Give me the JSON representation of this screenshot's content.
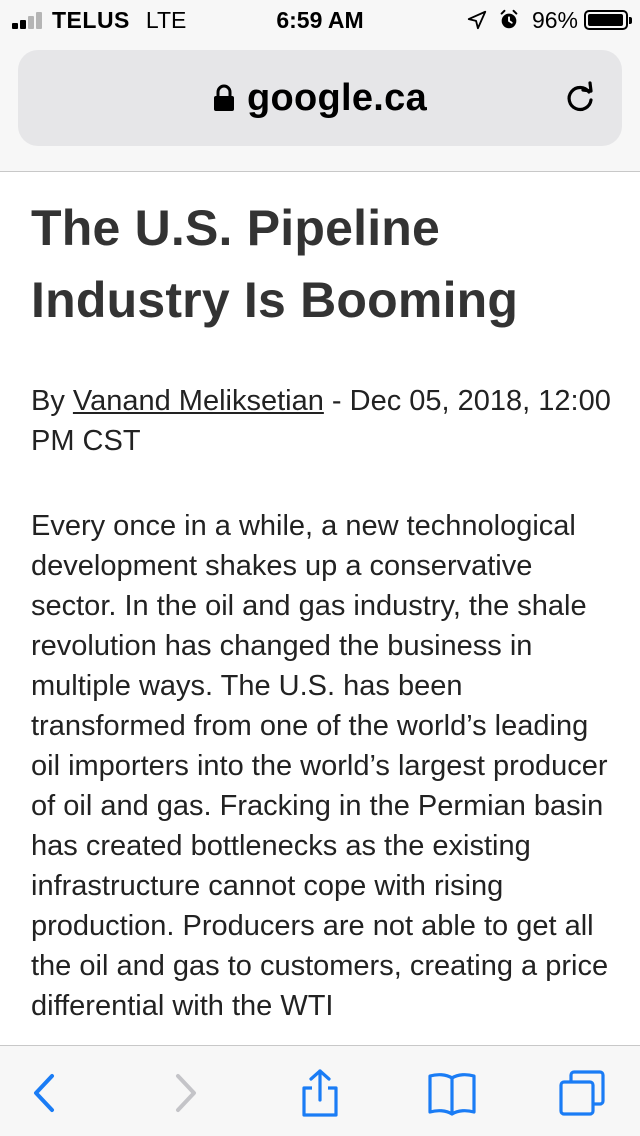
{
  "status_bar": {
    "carrier": "TELUS",
    "network": "LTE",
    "time": "6:59 AM",
    "battery_percent": "96%",
    "battery_level": 0.96,
    "signal_bars_filled": 2,
    "signal_bars_total": 4
  },
  "address_bar": {
    "domain": "google.ca",
    "lock_icon": "lock-icon",
    "reload_icon": "reload-icon"
  },
  "article": {
    "headline": "The U.S. Pipeline Industry Is Booming",
    "byline_prefix": "By ",
    "author": "Vanand Meliksetian",
    "byline_suffix": " - Dec 05, 2018, 12:00 PM CST",
    "body": "Every once in a while, a new technological development shakes up a conservative sector. In the oil and gas industry, the shale revolution has changed the business in multiple ways. The U.S. has been transformed from one of the world’s leading oil importers into the world’s largest producer of oil and gas. Fracking in the Permian basin has created bottlenecks as the existing infrastructure cannot cope with rising production. Producers are not able to get all the oil and gas to customers, creating a price differential with the WTI"
  },
  "toolbar": {
    "icons": [
      "back-icon",
      "forward-icon",
      "share-icon",
      "bookmarks-icon",
      "tabs-icon"
    ]
  },
  "colors": {
    "accent": "#1a7cf5",
    "disabled": "#c4c4c8",
    "headline": "#333333",
    "text": "#222222",
    "bar_background": "#f7f7f7",
    "address_field": "#e6e6e8"
  }
}
